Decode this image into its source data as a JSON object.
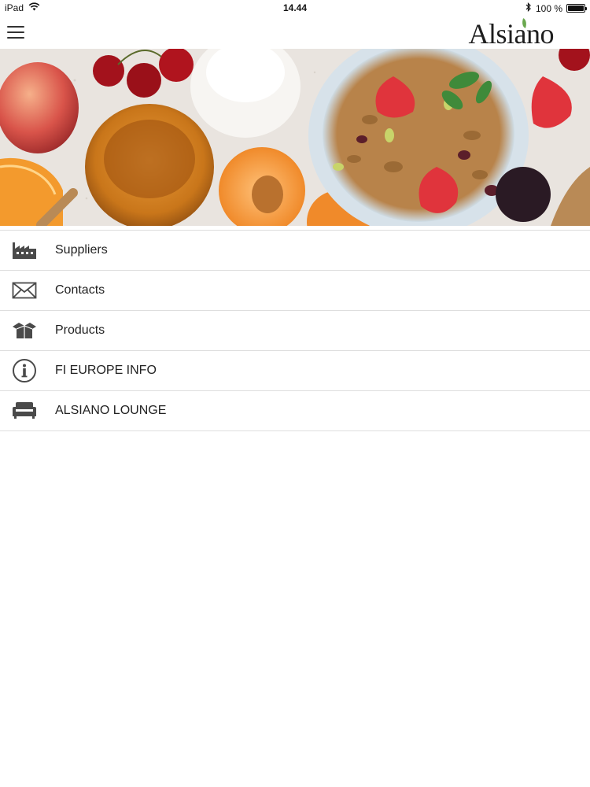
{
  "status_bar": {
    "device": "iPad",
    "time": "14.44",
    "battery_text": "100 %",
    "battery_level": 1.0,
    "icons": [
      "wifi-icon",
      "bluetooth-icon",
      "battery-icon"
    ]
  },
  "header": {
    "menu_icon": "hamburger-menu-icon",
    "logo_text": "Alsiano",
    "logo_leaf_color": "#6aa84f"
  },
  "hero": {
    "image_subject": "breakfast foods banner",
    "colors": {
      "background": "#e9e4df",
      "honey": "#c9761a",
      "orange": "#f39a2d",
      "strawberry": "#e0343c",
      "granola": "#b8834a",
      "cherry": "#a3121c",
      "milk": "#f7f5f2"
    }
  },
  "menu": {
    "items": [
      {
        "label": "Suppliers",
        "icon": "factory-icon"
      },
      {
        "label": "Contacts",
        "icon": "envelope-icon"
      },
      {
        "label": "Products",
        "icon": "box-icon"
      },
      {
        "label": "FI EUROPE INFO",
        "icon": "info-icon"
      },
      {
        "label": "ALSIANO LOUNGE",
        "icon": "sofa-icon"
      }
    ],
    "icon_color": "#4a4a4a",
    "divider_color": "#dedede"
  }
}
